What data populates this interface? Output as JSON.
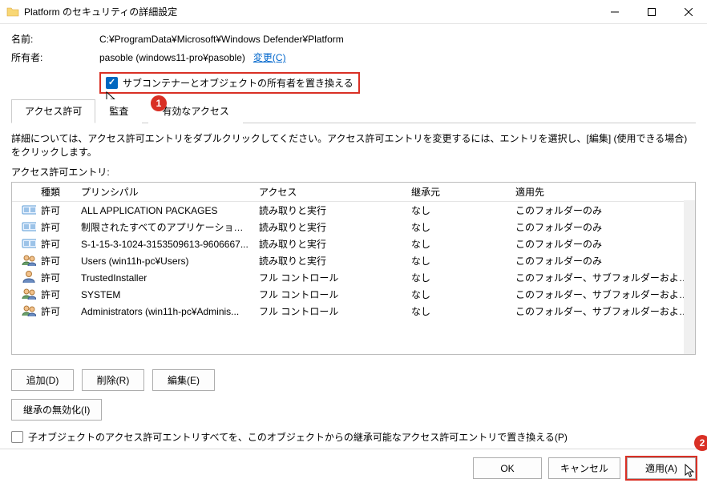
{
  "window": {
    "title": "Platform のセキュリティの詳細設定"
  },
  "header": {
    "name_label": "名前:",
    "name_value": "C:¥ProgramData¥Microsoft¥Windows Defender¥Platform",
    "owner_label": "所有者:",
    "owner_value": "pasoble (windows11-pro¥pasoble)",
    "change_link_text": "変更",
    "change_link_accel": "(C)",
    "replace_owner_label": "サブコンテナーとオブジェクトの所有者を置き換える"
  },
  "tabs": {
    "permissions": "アクセス許可",
    "auditing": "監査",
    "effective": "有効なアクセス"
  },
  "hint_text": "詳細については、アクセス許可エントリをダブルクリックしてください。アクセス許可エントリを変更するには、エントリを選択し、[編集] (使用できる場合) をクリックします。",
  "entries_label": "アクセス許可エントリ:",
  "columns": {
    "type": "種類",
    "principal": "プリンシパル",
    "access": "アクセス",
    "inherited": "継承元",
    "applies": "適用先"
  },
  "rows": [
    {
      "icon": "pkg",
      "type": "許可",
      "principal": "ALL APPLICATION PACKAGES",
      "access": "読み取りと実行",
      "inherited": "なし",
      "applies": "このフォルダーのみ"
    },
    {
      "icon": "pkg",
      "type": "許可",
      "principal": "制限されたすべてのアプリケーション パッケ...",
      "access": "読み取りと実行",
      "inherited": "なし",
      "applies": "このフォルダーのみ"
    },
    {
      "icon": "pkg",
      "type": "許可",
      "principal": "S-1-15-3-1024-3153509613-9606667...",
      "access": "読み取りと実行",
      "inherited": "なし",
      "applies": "このフォルダーのみ"
    },
    {
      "icon": "grp",
      "type": "許可",
      "principal": "Users (win11h-pc¥Users)",
      "access": "読み取りと実行",
      "inherited": "なし",
      "applies": "このフォルダーのみ"
    },
    {
      "icon": "usr",
      "type": "許可",
      "principal": "TrustedInstaller",
      "access": "フル コントロール",
      "inherited": "なし",
      "applies": "このフォルダー、サブフォルダーおよびファイル"
    },
    {
      "icon": "grp",
      "type": "許可",
      "principal": "SYSTEM",
      "access": "フル コントロール",
      "inherited": "なし",
      "applies": "このフォルダー、サブフォルダーおよびファイル"
    },
    {
      "icon": "grp",
      "type": "許可",
      "principal": "Administrators (win11h-pc¥Adminis...",
      "access": "フル コントロール",
      "inherited": "なし",
      "applies": "このフォルダー、サブフォルダーおよびファイル"
    }
  ],
  "buttons": {
    "add": "追加(D)",
    "remove": "削除(R)",
    "edit": "編集(E)",
    "disable_inherit": "継承の無効化(I)",
    "replace_child": "子オブジェクトのアクセス許可エントリすべてを、このオブジェクトからの継承可能なアクセス許可エントリで置き換える(P)",
    "ok": "OK",
    "cancel": "キャンセル",
    "apply": "適用(A)"
  },
  "callouts": {
    "step1": "1",
    "step2": "2"
  }
}
